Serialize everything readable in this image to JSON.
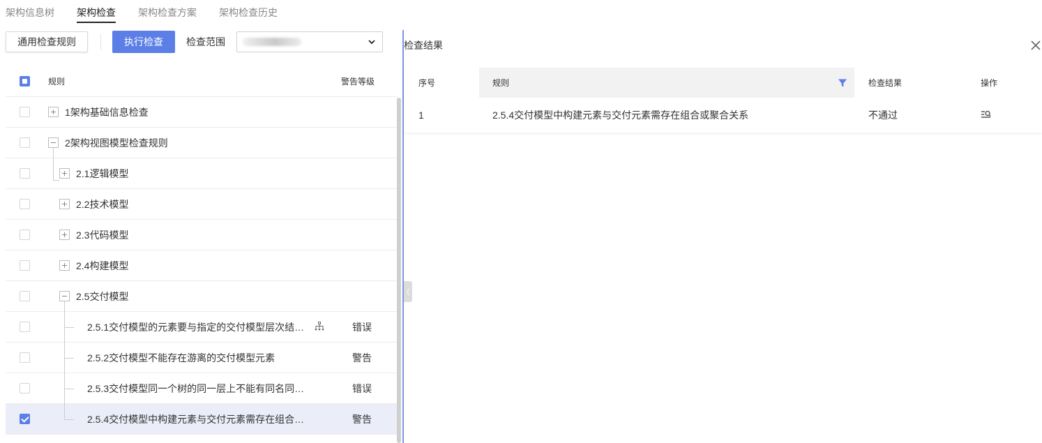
{
  "tabs": [
    {
      "label": "架构信息树",
      "active": false
    },
    {
      "label": "架构检查",
      "active": true
    },
    {
      "label": "架构检查方案",
      "active": false
    },
    {
      "label": "架构检查历史",
      "active": false
    }
  ],
  "toolbar": {
    "rule_button": "通用检查规则",
    "exec_button": "执行检查",
    "scope_label": "检查范围"
  },
  "left_table": {
    "headers": {
      "rule": "规则",
      "level": "警告等级"
    },
    "rows": [
      {
        "name": "1架构基础信息检查",
        "level": "",
        "checked": false
      },
      {
        "name": "2架构视图模型检查规则",
        "level": "",
        "checked": false
      },
      {
        "name": "2.1逻辑模型",
        "level": "",
        "checked": false
      },
      {
        "name": "2.2技术模型",
        "level": "",
        "checked": false
      },
      {
        "name": "2.3代码模型",
        "level": "",
        "checked": false
      },
      {
        "name": "2.4构建模型",
        "level": "",
        "checked": false
      },
      {
        "name": "2.5交付模型",
        "level": "",
        "checked": false
      },
      {
        "name": "2.5.1交付模型的元素要与指定的交付模型层次结…",
        "level": "错误",
        "checked": false
      },
      {
        "name": "2.5.2交付模型不能存在游离的交付模型元素",
        "level": "警告",
        "checked": false
      },
      {
        "name": "2.5.3交付模型同一个树的同一层上不能有同名同…",
        "level": "错误",
        "checked": false
      },
      {
        "name": "2.5.4交付模型中构建元素与交付元素需存在组合…",
        "level": "警告",
        "checked": true
      }
    ]
  },
  "result_panel": {
    "title": "检查结果",
    "headers": {
      "index": "序号",
      "rule": "规则",
      "result": "检查结果",
      "action": "操作"
    },
    "rows": [
      {
        "index": "1",
        "rule": "2.5.4交付模型中构建元素与交付元素需存在组合或聚合关系",
        "result": "不通过"
      }
    ]
  },
  "colors": {
    "accent": "#5b7fe6",
    "divider": "#7b96e0",
    "selected_row": "#ebeef8"
  }
}
